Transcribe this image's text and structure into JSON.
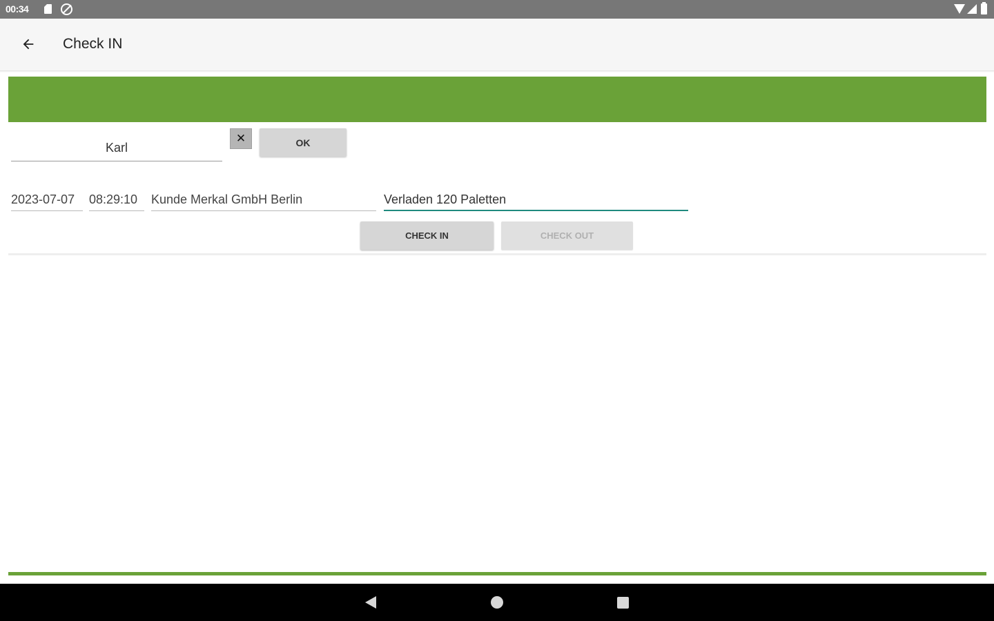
{
  "status_bar": {
    "time": "00:34",
    "icons": [
      "sd-card-icon",
      "location-off-icon",
      "wifi-icon",
      "signal-icon",
      "battery-icon"
    ]
  },
  "app_bar": {
    "back_icon": "arrow-left-icon",
    "title": "Check IN"
  },
  "colors": {
    "accent_green": "#6aa238",
    "focus_teal": "#1f8a7e",
    "status_bar": "#777777"
  },
  "name_row": {
    "name_value": "Karl",
    "clear_label": "✕",
    "ok_label": "OK"
  },
  "entry": {
    "date": "2023-07-07",
    "time": "08:29:10",
    "customer": "Kunde Merkal GmbH Berlin",
    "note": "Verladen 120 Paletten"
  },
  "actions": {
    "check_in_label": "CHECK IN",
    "check_out_label": "CHECK OUT",
    "check_out_enabled": false
  },
  "nav_bar": {
    "icons": [
      "nav-back-icon",
      "nav-home-icon",
      "nav-recents-icon"
    ]
  }
}
